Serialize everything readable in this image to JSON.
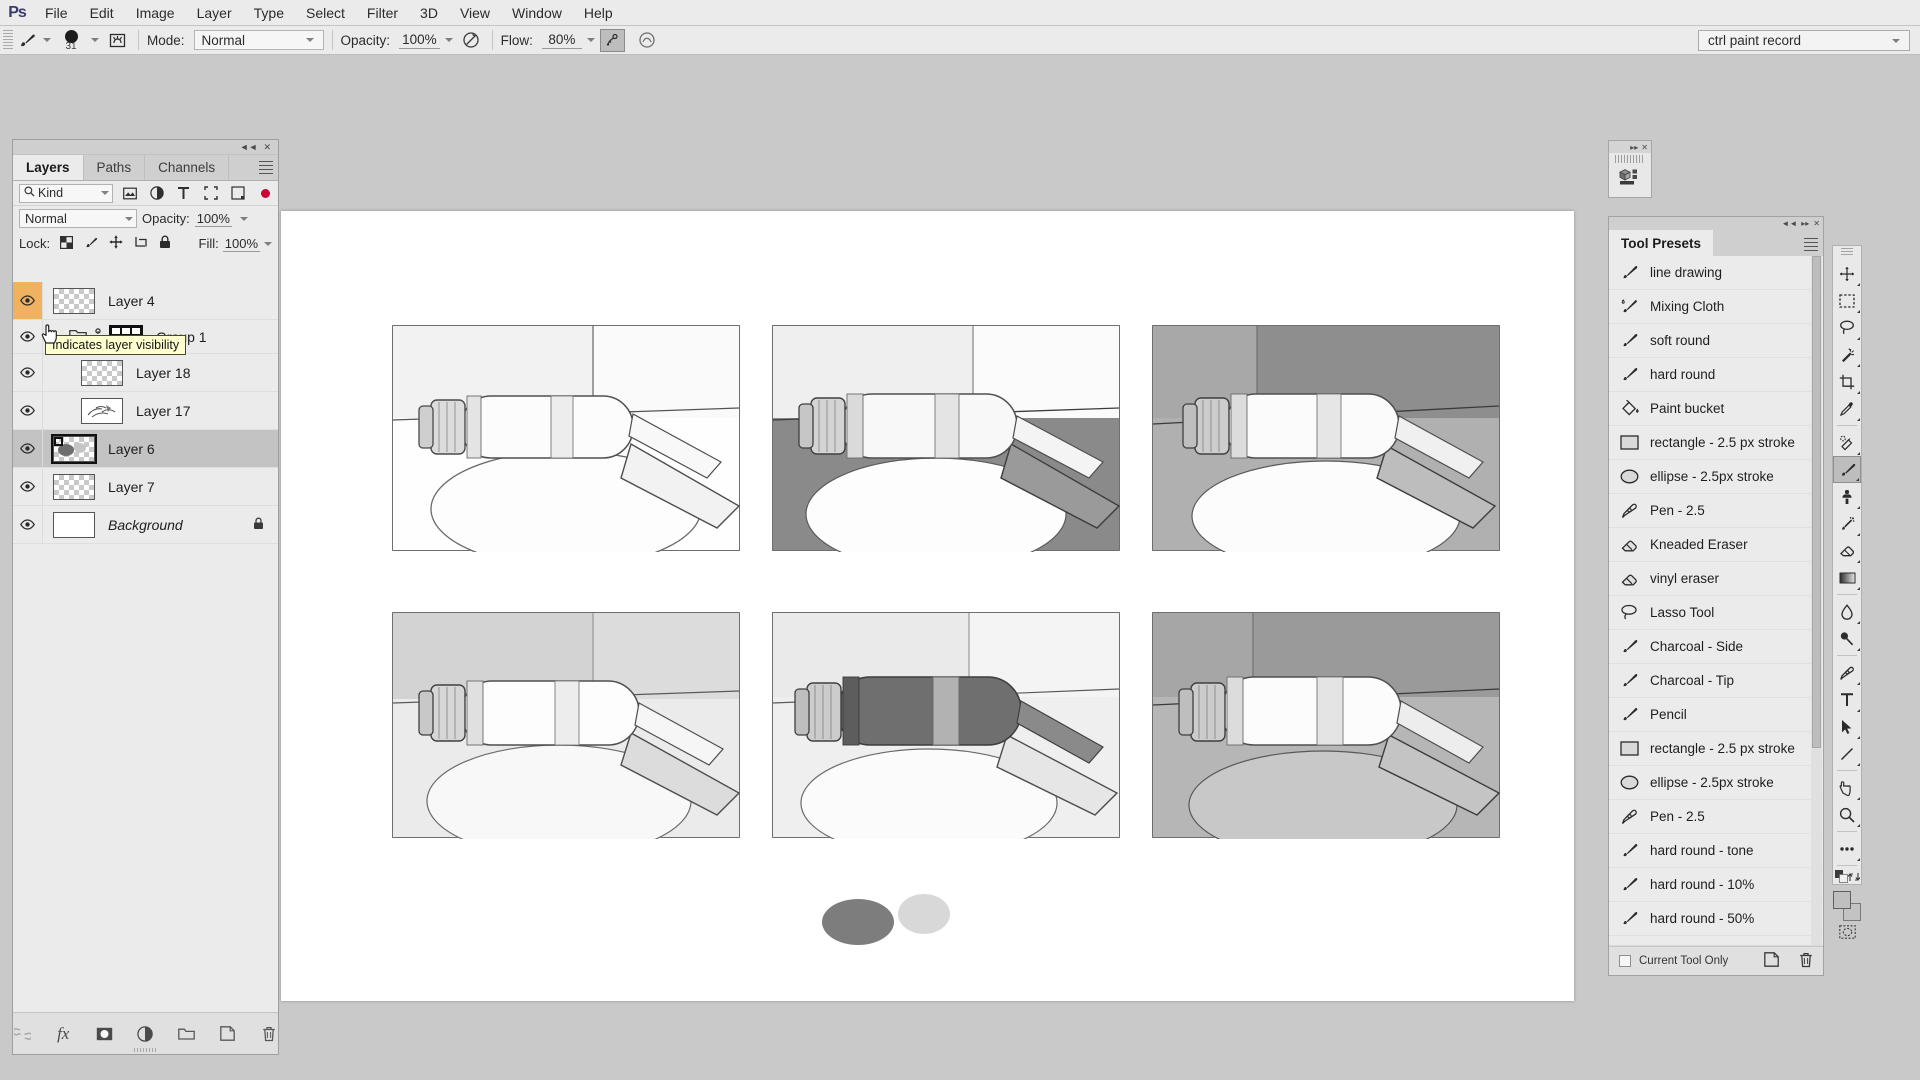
{
  "app": {
    "logo": "Ps",
    "menus": [
      "File",
      "Edit",
      "Image",
      "Layer",
      "Type",
      "Select",
      "Filter",
      "3D",
      "View",
      "Window",
      "Help"
    ]
  },
  "options_bar": {
    "brush_tool_icon": "brush-icon",
    "brush_size": "31",
    "brush_picker_caret": "chevron-down-icon",
    "tablet_icon": "brush-panel-icon",
    "mode_label": "Mode:",
    "mode_value": "Normal",
    "opacity_label": "Opacity:",
    "opacity_value": "100%",
    "pressure_opacity_icon": "pressure-opacity-icon",
    "flow_label": "Flow:",
    "flow_value": "80%",
    "airbrush_icon": "airbrush-icon",
    "smoothing_icon": "smoothing-icon",
    "preset_picker_value": "ctrl paint record",
    "preset_picker_caret": "chevron-down-icon"
  },
  "layers_panel": {
    "tabs": [
      {
        "label": "Layers",
        "active": true
      },
      {
        "label": "Paths",
        "active": false
      },
      {
        "label": "Channels",
        "active": false
      }
    ],
    "filter": {
      "search_icon": "search-icon",
      "kind_value": "Kind",
      "kind_caret": "chevron-down-icon",
      "icons": [
        "pixel-filter-icon",
        "adjustment-filter-icon",
        "type-filter-icon",
        "shape-filter-icon",
        "smart-object-filter-icon"
      ],
      "toggle_name": "filter-enable-toggle"
    },
    "blend": {
      "mode_value": "Normal",
      "mode_caret": "chevron-down-icon",
      "opacity_label": "Opacity:",
      "opacity_value": "100%",
      "opacity_caret": "chevron-down-icon"
    },
    "lock": {
      "label": "Lock:",
      "icons": [
        "lock-transparent-pixels-icon",
        "lock-image-pixels-icon",
        "lock-position-icon",
        "lock-artboard-icon",
        "lock-all-icon"
      ],
      "fill_label": "Fill:",
      "fill_value": "100%",
      "fill_caret": "chevron-down-icon"
    },
    "rows": [
      {
        "name": "Layer 4",
        "visible": true,
        "selected": false,
        "eye_accent": true,
        "kind": "transparent",
        "indent": 0,
        "italic": false,
        "locked": false
      },
      {
        "name": "Group 1",
        "visible": true,
        "selected": false,
        "eye_accent": false,
        "kind": "group",
        "indent": 0,
        "italic": false,
        "locked": false
      },
      {
        "name": "Layer 18",
        "visible": true,
        "selected": false,
        "eye_accent": false,
        "kind": "transparent",
        "indent": 1,
        "italic": false,
        "locked": false
      },
      {
        "name": "Layer 17",
        "visible": true,
        "selected": false,
        "eye_accent": false,
        "kind": "sketch",
        "indent": 1,
        "italic": false,
        "locked": false
      },
      {
        "name": "Layer 6",
        "visible": true,
        "selected": true,
        "eye_accent": false,
        "kind": "blobs",
        "indent": 0,
        "italic": false,
        "locked": false
      },
      {
        "name": "Layer 7",
        "visible": true,
        "selected": false,
        "eye_accent": false,
        "kind": "transparent",
        "indent": 0,
        "italic": false,
        "locked": false
      },
      {
        "name": "Background",
        "visible": true,
        "selected": false,
        "eye_accent": false,
        "kind": "white",
        "indent": 0,
        "italic": true,
        "locked": true
      }
    ],
    "tooltip": "Indicates layer visibility",
    "footer_icons": [
      "link-layers-icon",
      "layer-style-fx-icon",
      "layer-mask-icon",
      "adjustment-layer-icon",
      "new-group-icon",
      "new-layer-icon",
      "delete-layer-icon"
    ]
  },
  "tool_presets": {
    "title": "Tool Presets",
    "menu_icon": "panel-menu-icon",
    "items": [
      {
        "label": "line drawing",
        "icon": "brush-icon"
      },
      {
        "label": "Mixing Cloth",
        "icon": "mixer-brush-icon"
      },
      {
        "label": "soft round",
        "icon": "brush-icon"
      },
      {
        "label": "hard round",
        "icon": "brush-icon"
      },
      {
        "label": "Paint bucket",
        "icon": "paint-bucket-icon"
      },
      {
        "label": "rectangle - 2.5 px stroke",
        "icon": "rectangle-icon"
      },
      {
        "label": "ellipse - 2.5px stroke",
        "icon": "ellipse-icon"
      },
      {
        "label": "Pen - 2.5",
        "icon": "pen-icon"
      },
      {
        "label": "Kneaded Eraser",
        "icon": "eraser-icon"
      },
      {
        "label": "vinyl eraser",
        "icon": "eraser-icon"
      },
      {
        "label": "Lasso Tool",
        "icon": "lasso-icon"
      },
      {
        "label": "Charcoal - Side",
        "icon": "brush-icon"
      },
      {
        "label": "Charcoal - Tip",
        "icon": "brush-icon"
      },
      {
        "label": "Pencil",
        "icon": "brush-icon"
      },
      {
        "label": "rectangle - 2.5 px stroke",
        "icon": "rectangle-icon"
      },
      {
        "label": "ellipse - 2.5px stroke",
        "icon": "ellipse-icon"
      },
      {
        "label": "Pen - 2.5",
        "icon": "pen-icon"
      },
      {
        "label": "hard round - tone",
        "icon": "brush-icon"
      },
      {
        "label": "hard round - 10%",
        "icon": "brush-icon"
      },
      {
        "label": "hard round - 50%",
        "icon": "brush-icon"
      }
    ],
    "footer": {
      "current_tool_only_label": "Current Tool Only",
      "new_preset_icon": "new-preset-icon",
      "delete_preset_icon": "delete-preset-icon"
    }
  },
  "toolbar": {
    "tools": [
      {
        "name": "move-tool",
        "active": false
      },
      {
        "name": "rectangular-marquee-tool",
        "active": false
      },
      {
        "name": "lasso-tool",
        "active": false
      },
      {
        "name": "magic-wand-tool",
        "active": false
      },
      {
        "name": "crop-tool",
        "active": false
      },
      {
        "name": "eyedropper-tool",
        "active": false
      },
      {
        "name": "spot-healing-brush-tool",
        "active": false
      },
      {
        "name": "brush-tool",
        "active": true
      },
      {
        "name": "clone-stamp-tool",
        "active": false
      },
      {
        "name": "history-brush-tool",
        "active": false
      },
      {
        "name": "eraser-tool",
        "active": false
      },
      {
        "name": "gradient-tool",
        "active": false
      },
      {
        "name": "blur-tool",
        "active": false
      },
      {
        "name": "dodge-tool",
        "active": false
      },
      {
        "name": "pen-tool",
        "active": false
      },
      {
        "name": "type-tool",
        "active": false
      },
      {
        "name": "path-selection-tool",
        "active": false
      },
      {
        "name": "line-shape-tool",
        "active": false
      },
      {
        "name": "hand-tool",
        "active": false
      },
      {
        "name": "zoom-tool",
        "active": false
      },
      {
        "name": "edit-toolbar-tool",
        "active": false
      }
    ],
    "default_colors_icon": "default-colors-icon",
    "swap_colors_icon": "swap-colors-icon",
    "quick-mask_icon": "quick-mask-icon",
    "foreground_color": "#bfbfbf",
    "background_color": "#c3c3c3"
  },
  "mini_panel": {
    "expand_icon": "expand-icon",
    "close_icon": "close-icon",
    "body_icon": "3d-panel-icon"
  },
  "canvas": {
    "description": "Six grayscale value-study thumbnails of a paint tube lying on a palette knife and saucer, plus two ellipse blobs below.",
    "tiles": [
      {
        "id": "tile-1",
        "bg_wall": "#f4f4f4",
        "bg_table": "#ffffff"
      },
      {
        "id": "tile-2",
        "bg_wall": "#8e8e8e",
        "bg_table": "#ffffff"
      },
      {
        "id": "tile-3",
        "bg_wall": "#a0a0a0",
        "bg_table": "#d8d8d8"
      },
      {
        "id": "tile-4",
        "bg_wall": "#d5d5d5",
        "bg_table": "#f2f2f2"
      },
      {
        "id": "tile-5",
        "bg_wall": "#ffffff",
        "bg_table": "#e6e6e6"
      },
      {
        "id": "tile-6",
        "bg_wall": "#9a9a9a",
        "bg_table": "#b4b4b4"
      }
    ],
    "blobs": [
      {
        "id": "blob-dark",
        "color": "#7d7d7d"
      },
      {
        "id": "blob-light",
        "color": "#d5d5d5"
      }
    ]
  },
  "theme": {
    "accent": "#f0b160",
    "panel_bg": "#ebebeb",
    "chrome_bg": "#c9c9c9",
    "selected_row": "#c3c3c3"
  }
}
